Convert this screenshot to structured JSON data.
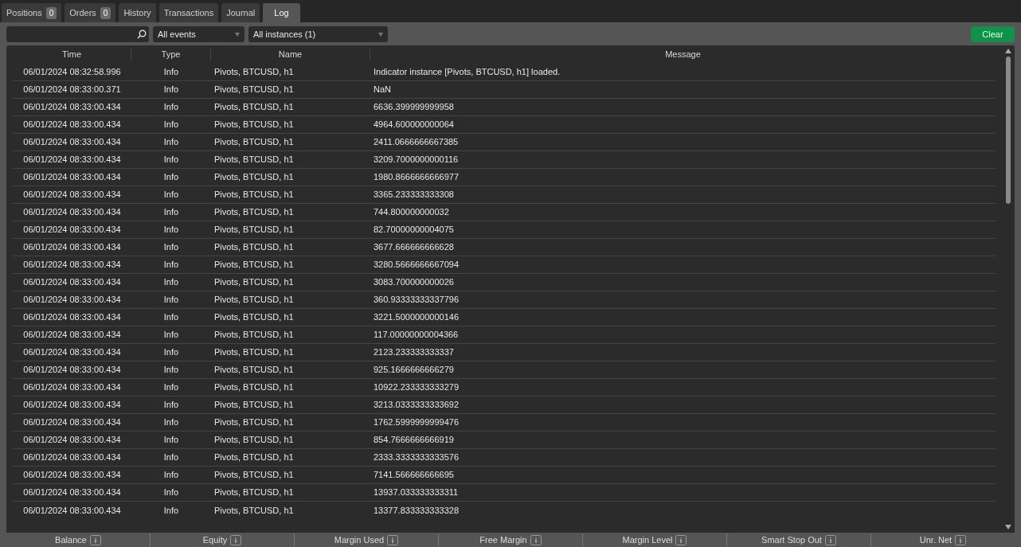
{
  "tabs": [
    {
      "label": "Positions",
      "badge": "0",
      "selected": false
    },
    {
      "label": "Orders",
      "badge": "0",
      "selected": false
    },
    {
      "label": "History",
      "selected": false
    },
    {
      "label": "Transactions",
      "selected": false
    },
    {
      "label": "Journal",
      "selected": false
    },
    {
      "label": "Log",
      "selected": true
    }
  ],
  "toolbar": {
    "event_filter": "All events",
    "instance_filter": "All instances (1)",
    "clear_button": "Clear"
  },
  "table": {
    "columns": [
      "Time",
      "Type",
      "Name",
      "Message"
    ],
    "rows": [
      {
        "time": "06/01/2024 08:32:58.996",
        "type": "Info",
        "name": "Pivots, BTCUSD, h1",
        "message": "Indicator instance [Pivots, BTCUSD, h1] loaded."
      },
      {
        "time": "06/01/2024 08:33:00.371",
        "type": "Info",
        "name": "Pivots, BTCUSD, h1",
        "message": "NaN"
      },
      {
        "time": "06/01/2024 08:33:00.434",
        "type": "Info",
        "name": "Pivots, BTCUSD, h1",
        "message": "6636.399999999958"
      },
      {
        "time": "06/01/2024 08:33:00.434",
        "type": "Info",
        "name": "Pivots, BTCUSD, h1",
        "message": "4964.600000000064"
      },
      {
        "time": "06/01/2024 08:33:00.434",
        "type": "Info",
        "name": "Pivots, BTCUSD, h1",
        "message": "2411.0666666667385"
      },
      {
        "time": "06/01/2024 08:33:00.434",
        "type": "Info",
        "name": "Pivots, BTCUSD, h1",
        "message": "3209.7000000000116"
      },
      {
        "time": "06/01/2024 08:33:00.434",
        "type": "Info",
        "name": "Pivots, BTCUSD, h1",
        "message": "1980.8666666666977"
      },
      {
        "time": "06/01/2024 08:33:00.434",
        "type": "Info",
        "name": "Pivots, BTCUSD, h1",
        "message": "3365.233333333308"
      },
      {
        "time": "06/01/2024 08:33:00.434",
        "type": "Info",
        "name": "Pivots, BTCUSD, h1",
        "message": "744.800000000032"
      },
      {
        "time": "06/01/2024 08:33:00.434",
        "type": "Info",
        "name": "Pivots, BTCUSD, h1",
        "message": "82.70000000004075"
      },
      {
        "time": "06/01/2024 08:33:00.434",
        "type": "Info",
        "name": "Pivots, BTCUSD, h1",
        "message": "3677.666666666628"
      },
      {
        "time": "06/01/2024 08:33:00.434",
        "type": "Info",
        "name": "Pivots, BTCUSD, h1",
        "message": "3280.5666666667094"
      },
      {
        "time": "06/01/2024 08:33:00.434",
        "type": "Info",
        "name": "Pivots, BTCUSD, h1",
        "message": "3083.700000000026"
      },
      {
        "time": "06/01/2024 08:33:00.434",
        "type": "Info",
        "name": "Pivots, BTCUSD, h1",
        "message": "360.93333333337796"
      },
      {
        "time": "06/01/2024 08:33:00.434",
        "type": "Info",
        "name": "Pivots, BTCUSD, h1",
        "message": "3221.5000000000146"
      },
      {
        "time": "06/01/2024 08:33:00.434",
        "type": "Info",
        "name": "Pivots, BTCUSD, h1",
        "message": "117.00000000004366"
      },
      {
        "time": "06/01/2024 08:33:00.434",
        "type": "Info",
        "name": "Pivots, BTCUSD, h1",
        "message": "2123.233333333337"
      },
      {
        "time": "06/01/2024 08:33:00.434",
        "type": "Info",
        "name": "Pivots, BTCUSD, h1",
        "message": "925.1666666666279"
      },
      {
        "time": "06/01/2024 08:33:00.434",
        "type": "Info",
        "name": "Pivots, BTCUSD, h1",
        "message": "10922.233333333279"
      },
      {
        "time": "06/01/2024 08:33:00.434",
        "type": "Info",
        "name": "Pivots, BTCUSD, h1",
        "message": "3213.0333333333692"
      },
      {
        "time": "06/01/2024 08:33:00.434",
        "type": "Info",
        "name": "Pivots, BTCUSD, h1",
        "message": "1762.5999999999476"
      },
      {
        "time": "06/01/2024 08:33:00.434",
        "type": "Info",
        "name": "Pivots, BTCUSD, h1",
        "message": "854.7666666666919"
      },
      {
        "time": "06/01/2024 08:33:00.434",
        "type": "Info",
        "name": "Pivots, BTCUSD, h1",
        "message": "2333.3333333333576"
      },
      {
        "time": "06/01/2024 08:33:00.434",
        "type": "Info",
        "name": "Pivots, BTCUSD, h1",
        "message": "7141.566666666695"
      },
      {
        "time": "06/01/2024 08:33:00.434",
        "type": "Info",
        "name": "Pivots, BTCUSD, h1",
        "message": "13937.033333333311"
      },
      {
        "time": "06/01/2024 08:33:00.434",
        "type": "Info",
        "name": "Pivots, BTCUSD, h1",
        "message": "13377.833333333328"
      }
    ]
  },
  "status_bar": [
    {
      "label": "Balance"
    },
    {
      "label": "Equity"
    },
    {
      "label": "Margin Used"
    },
    {
      "label": "Free Margin"
    },
    {
      "label": "Margin Level"
    },
    {
      "label": "Smart Stop Out"
    },
    {
      "label": "Unr. Net"
    }
  ]
}
